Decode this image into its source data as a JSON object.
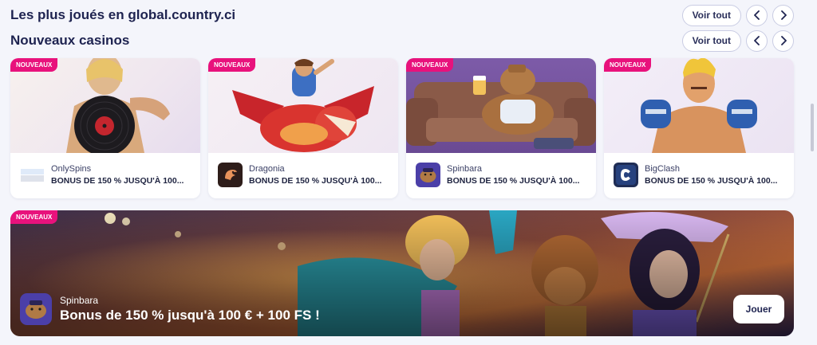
{
  "sections": [
    {
      "title": "Les plus joués en global.country.ci",
      "see_all": "Voir tout"
    },
    {
      "title": "Nouveaux casinos",
      "see_all": "Voir tout"
    }
  ],
  "icons": {
    "prev": "chevron-left-icon",
    "next": "chevron-right-icon"
  },
  "cards": [
    {
      "badge": "NOUVEAUX",
      "name": "OnlySpins",
      "bonus": "BONUS DE 150 % JUSQU'À 100...",
      "logo_text": "ONLY SPINS"
    },
    {
      "badge": "NOUVEAUX",
      "name": "Dragonia",
      "bonus": "BONUS DE 150 % JUSQU'À 100...",
      "logo_text": ""
    },
    {
      "badge": "NOUVEAUX",
      "name": "Spinbara",
      "bonus": "BONUS DE 150 % JUSQU'À 100...",
      "logo_text": ""
    },
    {
      "badge": "NOUVEAUX",
      "name": "BigClash",
      "bonus": "BONUS DE 150 % JUSQU'À 100...",
      "logo_text": "C"
    }
  ],
  "banner": {
    "badge": "NOUVEAUX",
    "name": "Spinbara",
    "bonus": "Bonus de 150 % jusqu'à 100 € + 100 FS !",
    "play": "Jouer"
  },
  "colors": {
    "badge": "#e8127c",
    "title": "#1e2350",
    "background": "#f4f5fb"
  }
}
